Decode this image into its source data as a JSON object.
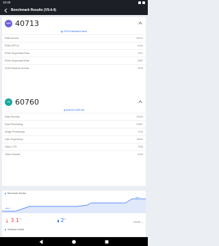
{
  "status_bar": {
    "time": "10:45"
  },
  "app_bar": {
    "title": "Benchmark Results (V9.4.4)"
  },
  "card1": {
    "badge": "GPU",
    "score": "40713",
    "hint": "GPU:Embedded result",
    "rows": [
      {
        "label": "RAM Access",
        "value": "25412"
      },
      {
        "label": "ROM APP IO",
        "value": "4444"
      },
      {
        "label": "ROM Sequential Read",
        "value": "3421"
      },
      {
        "label": "ROM Sequential Write",
        "value": "2857"
      },
      {
        "label": "ROM Random Access",
        "value": "4029"
      }
    ]
  },
  "card2": {
    "badge": "UX",
    "score": "60760",
    "hint": "Android 11(64 bit)",
    "rows": [
      {
        "label": "Data Security",
        "value": "13026"
      },
      {
        "label": "Data Processing",
        "value": "12867"
      },
      {
        "label": "Image Processing",
        "value": "7415"
      },
      {
        "label": "User Experience",
        "value": "15829"
      },
      {
        "label": "Video CTS",
        "value": "7008"
      },
      {
        "label": "Video Decode",
        "value": "3154"
      }
    ]
  },
  "monitor": {
    "title": "Benchmark Monitor",
    "start_label": "28.0°",
    "end_label": "31.1°",
    "temp_rise": "3.1",
    "temp_rise_unit": "°C",
    "battery_drop": "2",
    "battery_unit": "%",
    "details": "Details"
  },
  "hardware": {
    "title": "Hardware Details"
  },
  "colors": {
    "blue_badge": "#6f62d8",
    "green_badge": "#19a7a0",
    "accent": "#2f6ef1"
  }
}
